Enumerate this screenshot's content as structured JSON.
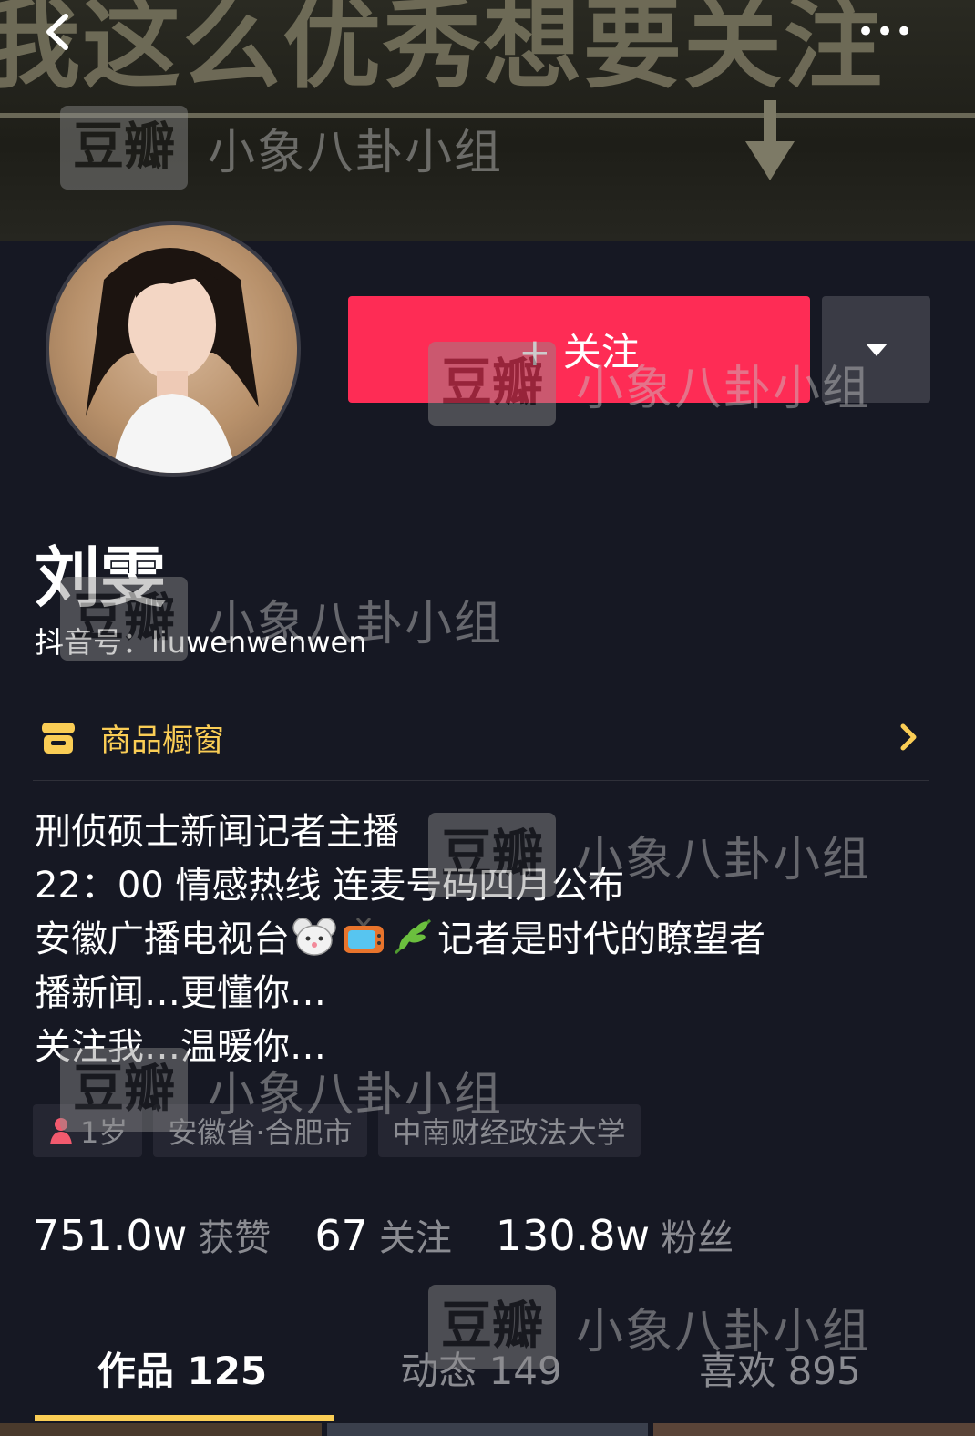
{
  "banner": {
    "text": "我这么优秀想要关注"
  },
  "nav": {
    "back_icon": "chevron-left-icon",
    "more_label": "•••"
  },
  "profile": {
    "name": "刘雯",
    "douyin_id": "抖音号：liuwenwenwen",
    "follow_label": "+ 关注",
    "dropdown_icon": "triangle-down-icon"
  },
  "shop": {
    "label": "商品橱窗",
    "icon": "shop-icon",
    "chevron_icon": "chevron-right-icon"
  },
  "bio": {
    "line1": "刑侦硕士新闻记者主播",
    "line2": "22：00 情感热线 连麦号码四月公布",
    "line3_pre": "安徽广播电视台",
    "line3_post": "记者是时代的瞭望者",
    "line4": "播新闻…更懂你…",
    "line5": "关注我…温暖你…"
  },
  "tags": {
    "age": "1岁",
    "location": "安徽省·合肥市",
    "school": "中南财经政法大学"
  },
  "stats": {
    "likes_num": "751.0w",
    "likes_label": "获赞",
    "following_num": "67",
    "following_label": "关注",
    "fans_num": "130.8w",
    "fans_label": "粉丝"
  },
  "tabs": {
    "works": "作品 125",
    "moments": "动态 149",
    "likes": "喜欢 895"
  },
  "watermark": {
    "box": "豆瓣",
    "text": "小象八卦小组"
  },
  "colors": {
    "background": "#161823",
    "accent": "#fe2c55",
    "highlight": "#facd55"
  }
}
